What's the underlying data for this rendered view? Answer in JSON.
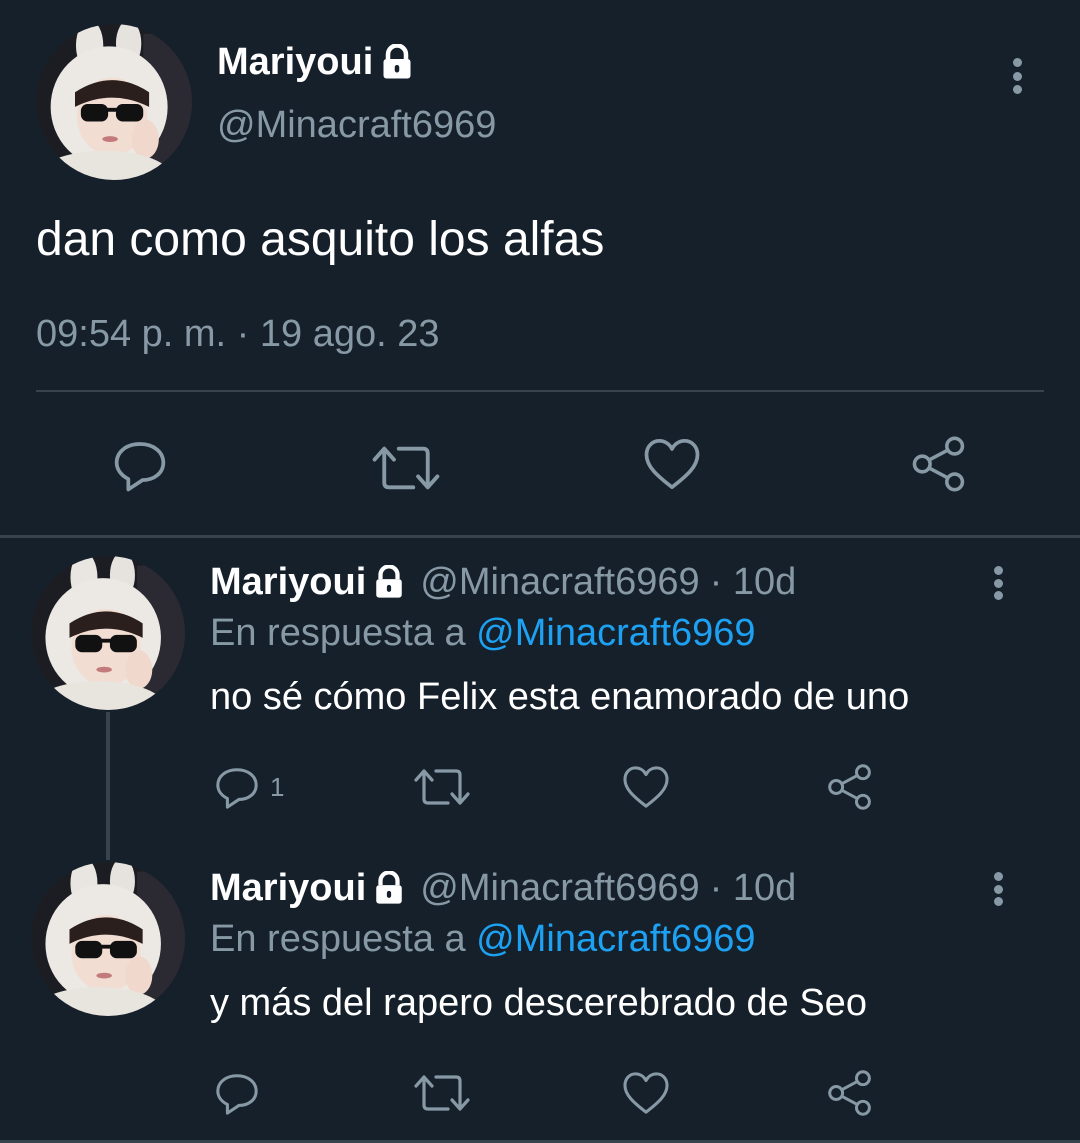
{
  "main_tweet": {
    "display_name": "Mariyoui",
    "handle": "@Minacraft6969",
    "text": "dan como asquito los alfas",
    "timestamp": "09:54 p. m. · 19 ago. 23",
    "protected_icon": "lock-icon",
    "actions": [
      "reply-icon",
      "retweet-icon",
      "like-icon",
      "share-icon"
    ]
  },
  "replies": [
    {
      "display_name": "Mariyoui",
      "handle": "@Minacraft6969",
      "age": "· 10d",
      "reply_prefix": "En respuesta a",
      "reply_to": "@Minacraft6969",
      "text": "no sé cómo Felix esta enamorado de uno",
      "reply_count": "1"
    },
    {
      "display_name": "Mariyoui",
      "handle": "@Minacraft6969",
      "age": "· 10d",
      "reply_prefix": "En respuesta a",
      "reply_to": "@Minacraft6969",
      "text": "y más del rapero descerebrado de Seo",
      "reply_count": ""
    }
  ],
  "colors": {
    "background": "#15202b",
    "muted": "#8899a6",
    "link": "#1da1f2",
    "divider": "#38444d"
  }
}
